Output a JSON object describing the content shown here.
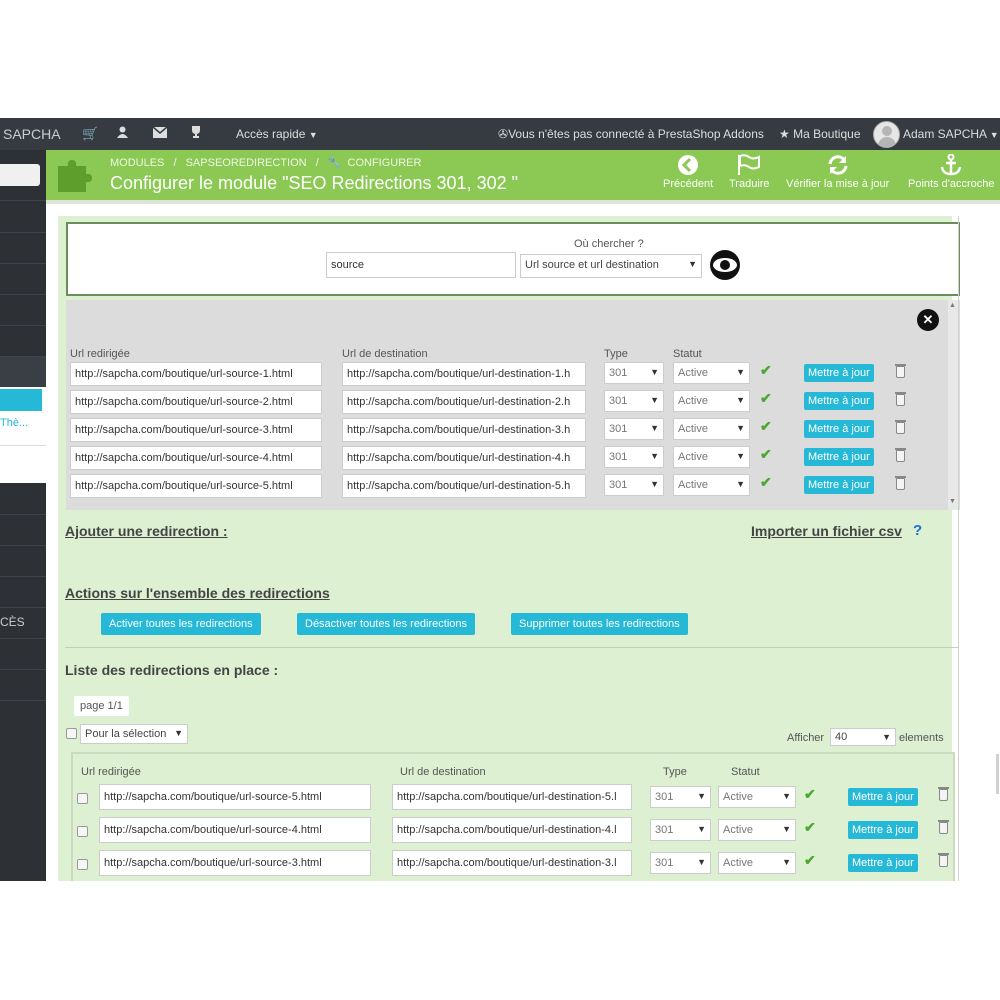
{
  "topbar": {
    "brand": "SAPCHA",
    "quick_access": "Accès rapide",
    "addons_status": "Vous n'êtes pas connecté à PrestaShop Addons",
    "shop": "Ma Boutique",
    "user": "Adam SAPCHA"
  },
  "sidebar": {
    "sub_label": "Thè...",
    "acces_label": "CÈS"
  },
  "header": {
    "breadcrumb": [
      "MODULES",
      "/",
      "SAPSEOREDIRECTION",
      "/",
      "CONFIGURER"
    ],
    "title": "Configurer le module \"SEO Redirections 301, 302 \"",
    "toolbar": [
      {
        "label": "Précédent",
        "icon": "arrow-left-circle-icon"
      },
      {
        "label": "Traduire",
        "icon": "flag-icon"
      },
      {
        "label": "Vérifier la mise à jour",
        "icon": "refresh-icon"
      },
      {
        "label": "Points d'accroche",
        "icon": "anchor-icon"
      }
    ]
  },
  "search": {
    "where_label": "Où chercher ?",
    "query": "source",
    "scope": "Url source et url destination"
  },
  "results": {
    "headers": {
      "source": "Url redirigée",
      "dest": "Url de destination",
      "type": "Type",
      "status": "Statut"
    },
    "rows": [
      {
        "source": "http://sapcha.com/boutique/url-source-1.html",
        "dest": "http://sapcha.com/boutique/url-destination-1.h",
        "type": "301",
        "status": "Active"
      },
      {
        "source": "http://sapcha.com/boutique/url-source-2.html",
        "dest": "http://sapcha.com/boutique/url-destination-2.h",
        "type": "301",
        "status": "Active"
      },
      {
        "source": "http://sapcha.com/boutique/url-source-3.html",
        "dest": "http://sapcha.com/boutique/url-destination-3.h",
        "type": "301",
        "status": "Active"
      },
      {
        "source": "http://sapcha.com/boutique/url-source-4.html",
        "dest": "http://sapcha.com/boutique/url-destination-4.h",
        "type": "301",
        "status": "Active"
      },
      {
        "source": "http://sapcha.com/boutique/url-source-5.html",
        "dest": "http://sapcha.com/boutique/url-destination-5.h",
        "type": "301",
        "status": "Active"
      }
    ],
    "update_label": "Mettre à jour"
  },
  "links": {
    "add_redirect": "Ajouter une redirection :",
    "import_csv": "Importer un fichier csv",
    "help": "?"
  },
  "bulk": {
    "title": "Actions sur l'ensemble des redirections",
    "activate": "Activer toutes les redirections",
    "deactivate": "Désactiver toutes les redirections",
    "delete": "Supprimer toutes les redirections"
  },
  "list": {
    "title": "Liste des redirections en place :",
    "page": "page 1/1",
    "bulk_select": "Pour la sélection",
    "show_label": "Afficher",
    "per_page": "40",
    "elements_label": "elements",
    "headers": {
      "source": "Url redirigée",
      "dest": "Url de destination",
      "type": "Type",
      "status": "Statut"
    },
    "rows": [
      {
        "source": "http://sapcha.com/boutique/url-source-5.html",
        "dest": "http://sapcha.com/boutique/url-destination-5.l",
        "type": "301",
        "status": "Active"
      },
      {
        "source": "http://sapcha.com/boutique/url-source-4.html",
        "dest": "http://sapcha.com/boutique/url-destination-4.l",
        "type": "301",
        "status": "Active"
      },
      {
        "source": "http://sapcha.com/boutique/url-source-3.html",
        "dest": "http://sapcha.com/boutique/url-destination-3.l",
        "type": "301",
        "status": "Active"
      }
    ],
    "update_label": "Mettre à jour"
  },
  "colors": {
    "accent": "#25b9d7",
    "header_green": "#8bc954",
    "topbar": "#363a41",
    "content_bg": "#ddf0d2"
  }
}
